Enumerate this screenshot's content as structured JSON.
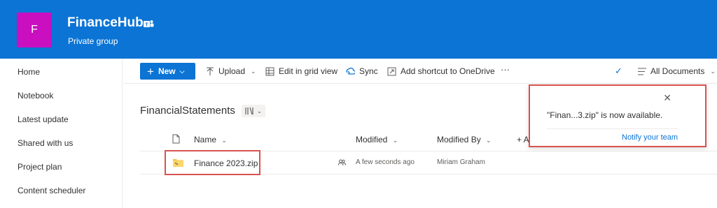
{
  "header": {
    "logo_letter": "F",
    "site_title": "FinanceHub",
    "site_subtitle": "Private group",
    "brand_color": "#0b74d5",
    "logo_color": "#c90fc0"
  },
  "leftnav": {
    "items": [
      "Home",
      "Notebook",
      "Latest update",
      "Shared with us",
      "Project plan",
      "Content scheduler"
    ]
  },
  "cmdbar": {
    "new_label": "New",
    "upload_label": "Upload",
    "grid_label": "Edit in grid view",
    "sync_label": "Sync",
    "shortcut_label": "Add shortcut to OneDrive",
    "more_label": "···",
    "view_label": "All Documents"
  },
  "library": {
    "title": "FinancialStatements",
    "columns": {
      "name": "Name",
      "modified": "Modified",
      "modified_by": "Modified By",
      "add_column": "+ A"
    },
    "rows": [
      {
        "name": "Finance 2023.zip",
        "modified": "A few seconds ago",
        "modified_by": "Miriam Graham"
      }
    ]
  },
  "toast": {
    "message": "\"Finan...3.zip\" is now available.",
    "link": "Notify your team",
    "highlight_color": "#d9534f"
  }
}
